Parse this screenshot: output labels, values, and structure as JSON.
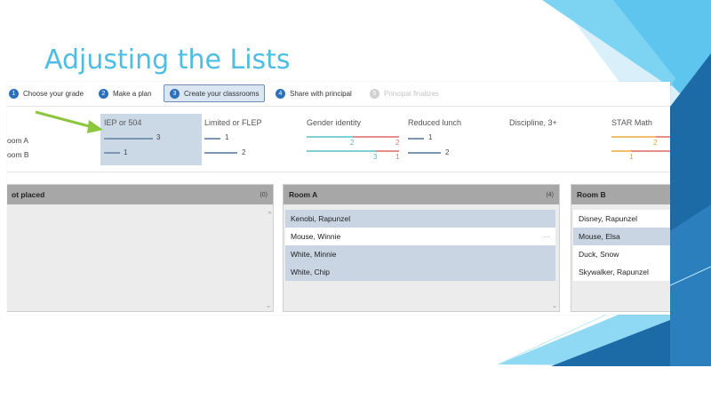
{
  "slide": {
    "title": "Adjusting the Lists"
  },
  "steps": [
    {
      "number": "1",
      "label": "Choose your grade"
    },
    {
      "number": "2",
      "label": "Make a plan"
    },
    {
      "number": "3",
      "label": "Create your classrooms"
    },
    {
      "number": "4",
      "label": "Share with principal"
    },
    {
      "number": "5",
      "label": "Principal finalizes"
    }
  ],
  "rooms": [
    "oom A",
    "oom B"
  ],
  "metrics": [
    {
      "label": "IEP or 504",
      "room_a": "3",
      "room_b": "1"
    },
    {
      "label": "Limited or FLEP",
      "room_a": "1",
      "room_b": "2"
    },
    {
      "label": "Gender identity",
      "room_a": "2",
      "room_a_second": "2",
      "room_b": "3",
      "room_b_second": "1"
    },
    {
      "label": "Reduced lunch",
      "room_a": "1",
      "room_b": "2"
    },
    {
      "label": "Discipline, 3+"
    },
    {
      "label": "STAR Math",
      "room_a": "2",
      "room_b": "1"
    }
  ],
  "panels": {
    "not_placed": {
      "title": "ot placed",
      "count": "(0)"
    },
    "room_a": {
      "title": "Room A",
      "count": "(4)",
      "students": [
        "Kenobi, Rapunzel",
        "Mouse, Winnie",
        "White, Minnie",
        "White, Chip"
      ]
    },
    "room_b": {
      "title": "Room B",
      "students": [
        "Disney, Rapunzel",
        "Mouse, Elsa",
        "Duck, Snow",
        "Skywalker, Rapunzel"
      ]
    }
  },
  "colors": {
    "title": "#4fbde3",
    "step_active_bg": "#dbe6f3",
    "highlight_column": "#cbd9e6",
    "gender_bar_teal": "#7fcfd8",
    "gender_bar_red": "#e98c8c",
    "math_bar_orange": "#f3c06a",
    "arrow_green": "#8cc63f",
    "deco_dark_blue": "#1c6aa6",
    "deco_light_blue": "#5dc5ee"
  }
}
